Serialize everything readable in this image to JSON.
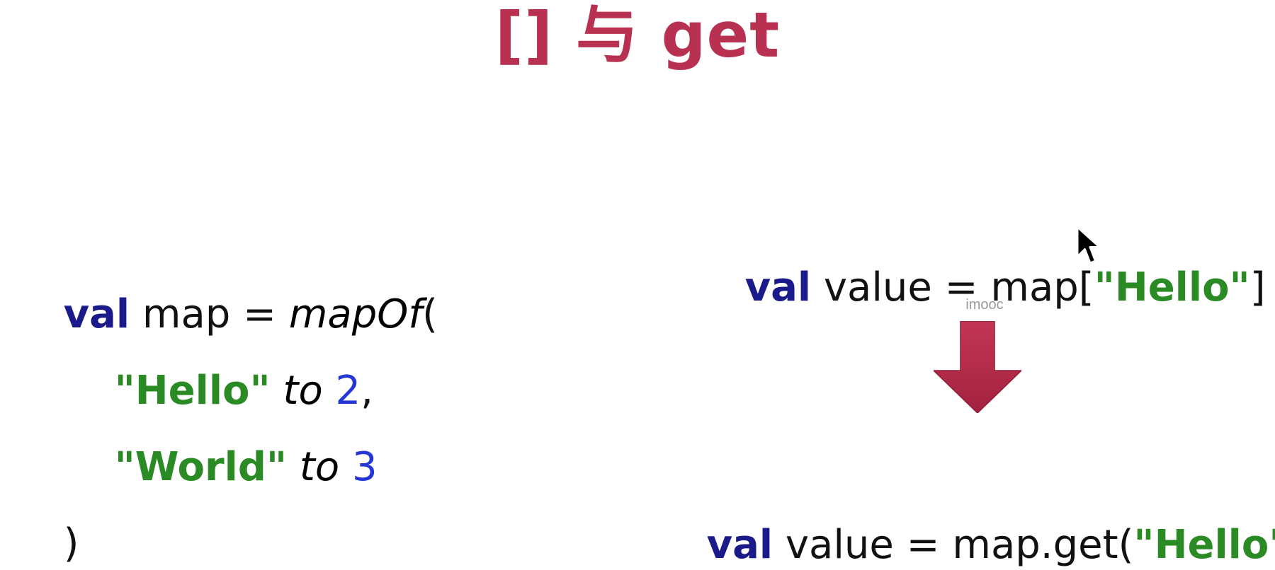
{
  "slide": {
    "title": "[] 与 get"
  },
  "left_code": {
    "line1": {
      "keyword": "val",
      "text": " map = ",
      "func": "mapOf",
      "paren": "("
    },
    "line2": {
      "string": "\"Hello\"",
      "infix": "to",
      "number": "2",
      "comma": ","
    },
    "line3": {
      "string": "\"World\"",
      "infix": "to",
      "number": "3"
    },
    "line4": {
      "paren": ")"
    }
  },
  "right_code": {
    "before": {
      "keyword": "val",
      "text": " value = map[",
      "string": "\"Hello\"",
      "close": "]"
    },
    "after": {
      "keyword": "val",
      "text": " value = map.get(",
      "string": "\"Hello\"",
      "close": ")"
    }
  },
  "watermark": "imooc",
  "colors": {
    "title": "#b93150",
    "keyword": "#1a1a8a",
    "string": "#2a8a24",
    "number": "#2436d6",
    "arrow": "#b52d4b"
  },
  "icons": {
    "arrow": "arrow-down-icon",
    "cursor": "mouse-pointer-icon"
  }
}
